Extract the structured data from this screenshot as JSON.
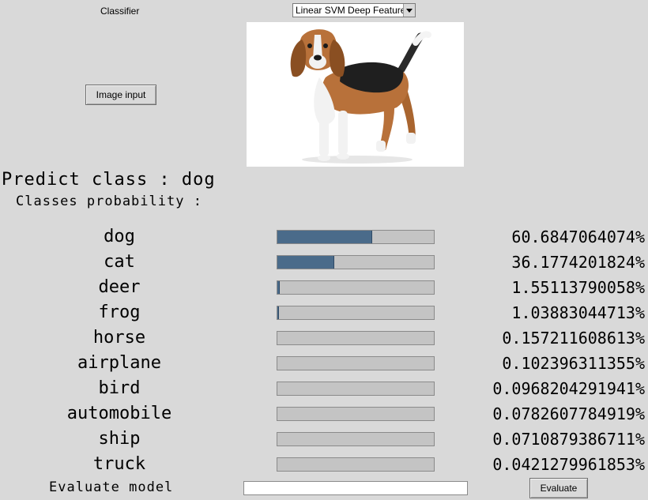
{
  "classifier": {
    "label": "Classifier",
    "selected": "Linear SVM Deep Features"
  },
  "image_input": {
    "button_label": "Image input"
  },
  "preview": {
    "icon": "beagle-dog-photo"
  },
  "prediction": {
    "title": "Predict class : dog",
    "subtitle": "Classes probability :"
  },
  "classes": [
    {
      "label": "dog",
      "value": "60.6847064074%",
      "fraction": 0.607
    },
    {
      "label": "cat",
      "value": "36.1774201824%",
      "fraction": 0.362
    },
    {
      "label": "deer",
      "value": "1.55113790058%",
      "fraction": 0.0155
    },
    {
      "label": "frog",
      "value": "1.03883044713%",
      "fraction": 0.0104
    },
    {
      "label": "horse",
      "value": "0.157211608613%",
      "fraction": 0.0016
    },
    {
      "label": "airplane",
      "value": "0.102396311355%",
      "fraction": 0.001
    },
    {
      "label": "bird",
      "value": "0.0968204291941%",
      "fraction": 0.001
    },
    {
      "label": "automobile",
      "value": "0.0782607784919%",
      "fraction": 0.0008
    },
    {
      "label": "ship",
      "value": "0.0710879386711%",
      "fraction": 0.0007
    },
    {
      "label": "truck",
      "value": "0.0421279961853%",
      "fraction": 0.0004
    }
  ],
  "evaluate": {
    "label": "Evaluate model",
    "field_value": "",
    "button_label": "Evaluate"
  },
  "colors": {
    "background": "#d9d9d9",
    "bar_fill": "#4a6b8a",
    "bar_track": "#c4c4c4"
  }
}
